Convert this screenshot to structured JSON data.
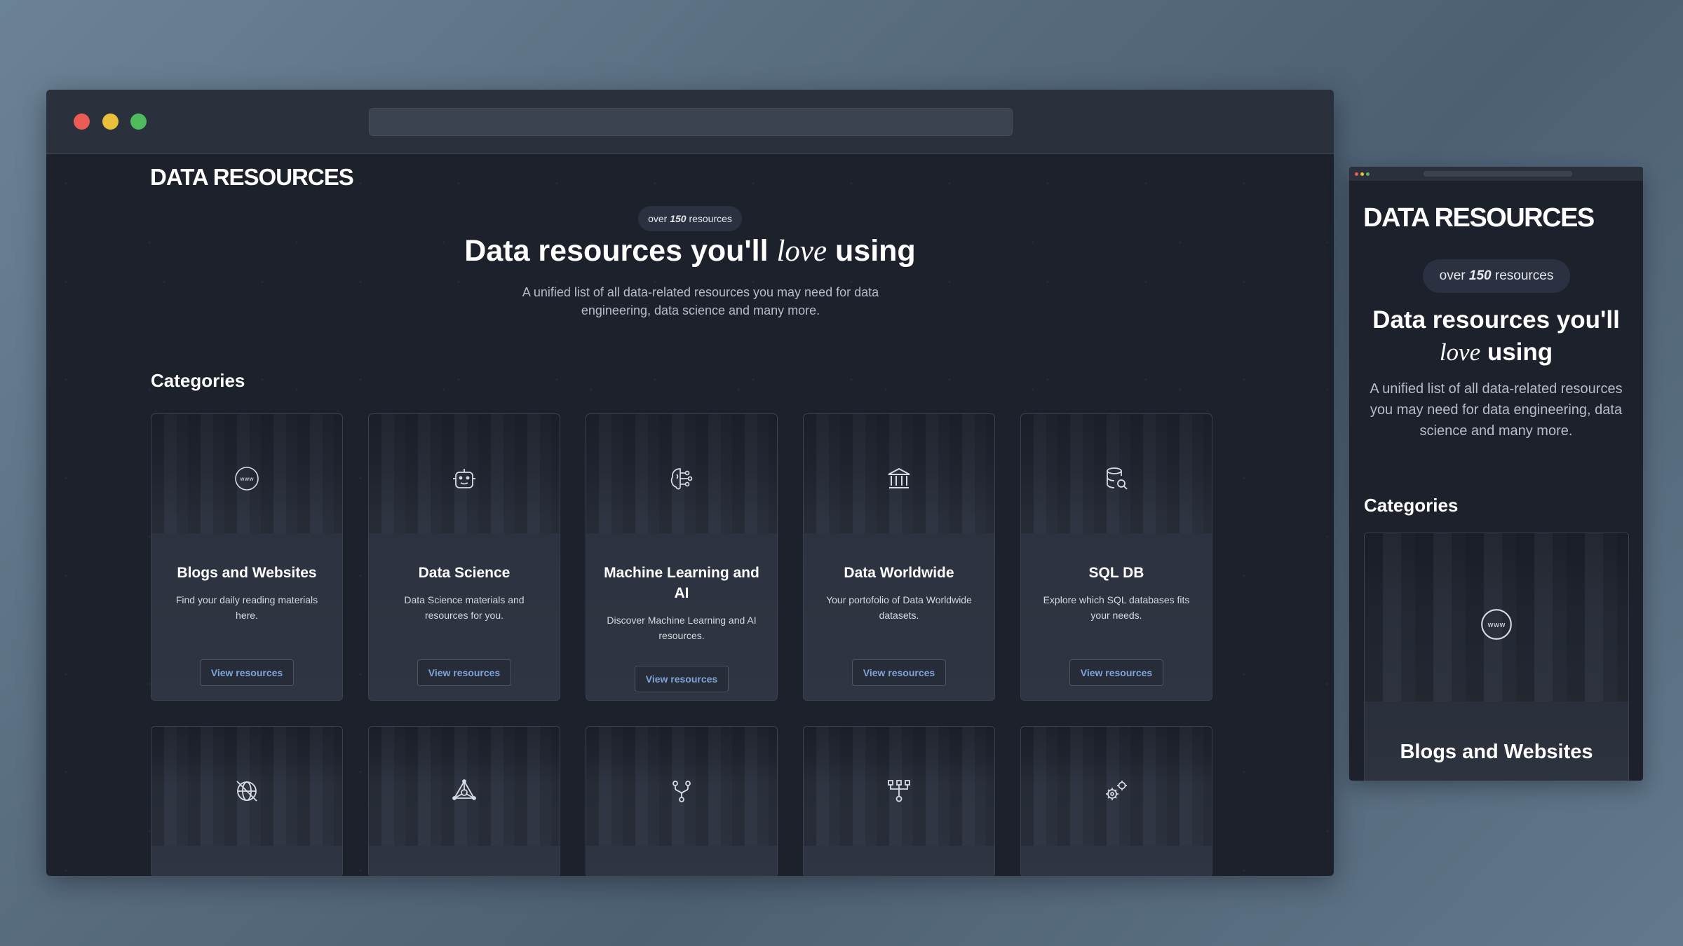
{
  "desktop": {
    "logo": "DATA RESOURCES",
    "badge": {
      "prefix": "over ",
      "count": "150",
      "suffix": " resources"
    },
    "hero": {
      "title_before": "Data resources you'll ",
      "title_love": "love",
      "title_after": " using",
      "subtitle": "A unified list of all data-related resources you may need for data engineering, data science and many more."
    },
    "categories_title": "Categories",
    "cards": [
      {
        "title": "Blogs and Websites",
        "desc": "Find your daily reading materials here.",
        "button": "View resources",
        "icon": "www-globe-icon"
      },
      {
        "title": "Data Science",
        "desc": "Data Science materials and resources for you.",
        "button": "View resources",
        "icon": "robot-icon"
      },
      {
        "title": "Machine Learning and AI",
        "desc": "Discover Machine Learning and AI resources.",
        "button": "View resources",
        "icon": "brain-circuit-icon"
      },
      {
        "title": "Data Worldwide",
        "desc": "Your portofolio of Data Worldwide datasets.",
        "button": "View resources",
        "icon": "bank-building-icon"
      },
      {
        "title": "SQL DB",
        "desc": "Explore which SQL databases fits your needs.",
        "button": "View resources",
        "icon": "database-search-icon"
      }
    ],
    "row2_icons": [
      "world-off-icon",
      "graph-network-icon",
      "git-branch-icon",
      "hierarchy-icon",
      "gears-icon"
    ]
  },
  "mobile": {
    "logo": "DATA RESOURCES",
    "badge": {
      "prefix": "over ",
      "count": "150",
      "suffix": " resources"
    },
    "title_before": "Data resources you'll ",
    "title_love": "love",
    "title_after": " using",
    "subtitle": "A unified list of all data-related resources you may need for data engineering, data science and many more.",
    "categories_title": "Categories",
    "first_card_title": "Blogs and Websites"
  },
  "colors": {
    "traffic_red": "#ed5b55",
    "traffic_yellow": "#e9bf3c",
    "traffic_green": "#4fbb5f",
    "button_text": "#7fa4d8"
  }
}
